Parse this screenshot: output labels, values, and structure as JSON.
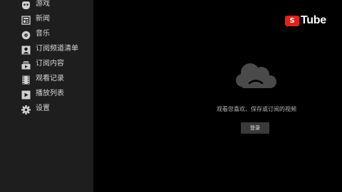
{
  "sidebar": {
    "items": [
      {
        "label": "游戏",
        "icon": "games-icon"
      },
      {
        "label": "新闻",
        "icon": "news-icon"
      },
      {
        "label": "音乐",
        "icon": "music-icon"
      },
      {
        "label": "订阅频道清单",
        "icon": "subscriptions-list-icon"
      },
      {
        "label": "订阅内容",
        "icon": "subscription-feed-icon"
      },
      {
        "label": "观看记录",
        "icon": "history-icon"
      },
      {
        "label": "播放列表",
        "icon": "playlist-icon"
      },
      {
        "label": "设置",
        "icon": "gear-icon"
      }
    ]
  },
  "header": {
    "logo_badge": "S",
    "logo_text": "Tube"
  },
  "main": {
    "empty_icon": "sad-cloud-icon",
    "message": "观看您喜欢、保存或订阅的视频",
    "login_label": "登录"
  },
  "colors": {
    "sidebar_bg": "#1e1e1e",
    "main_bg": "#000000",
    "brand_red": "#e62117",
    "button_bg": "#3a3a3a"
  }
}
